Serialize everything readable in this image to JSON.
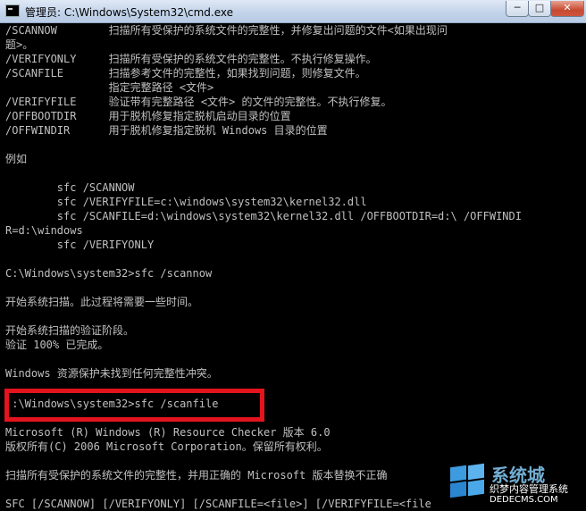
{
  "window": {
    "title": "管理员: C:\\Windows\\System32\\cmd.exe",
    "minimize": "─",
    "maximize": "□",
    "close": "✕"
  },
  "console": {
    "lines": [
      "/SCANNOW        扫描所有受保护的系统文件的完整性，并修复出问题的文件<如果出现问",
      "题>。",
      "/VERIFYONLY     扫描所有受保护的系统文件的完整性。不执行修复操作。",
      "/SCANFILE       扫描参考文件的完整性，如果找到问题，则修复文件。",
      "                指定完整路径 <文件>",
      "/VERIFYFILE     验证带有完整路径 <文件> 的文件的完整性。不执行修复。",
      "/OFFBOOTDIR     用于脱机修复指定脱机启动目录的位置",
      "/OFFWINDIR      用于脱机修复指定脱机 Windows 目录的位置",
      "",
      "例如",
      "",
      "        sfc /SCANNOW",
      "        sfc /VERIFYFILE=c:\\windows\\system32\\kernel32.dll",
      "        sfc /SCANFILE=d:\\windows\\system32\\kernel32.dll /OFFBOOTDIR=d:\\ /OFFWINDI",
      "R=d:\\windows",
      "        sfc /VERIFYONLY",
      "",
      "C:\\Windows\\system32>sfc /scannow",
      "",
      "开始系统扫描。此过程将需要一些时间。",
      "",
      "开始系统扫描的验证阶段。",
      "验证 100% 已完成。",
      "",
      "Windows 资源保护未找到任何完整性冲突。",
      "",
      " :\\Windows\\system32>sfc /scanfile",
      "Microsoft (R) Windows (R) Resource Checker 版本 6.0",
      "版权所有(C) 2006 Microsoft Corporation。保留所有权利。",
      "",
      "扫描所有受保护的系统文件的完整性，并用正确的 Microsoft 版本替换不正确",
      "",
      "SFC [/SCANNOW] [/VERIFYONLY] [/SCANFILE=<file>] [/VERIFYFILE=<file"
    ]
  },
  "watermark": {
    "title": "系统城",
    "subtitle": "织梦内容管理系统",
    "url": "DEDECMS.COM"
  },
  "colors": {
    "console_bg": "#000000",
    "console_text": "#c0c0c0",
    "highlight_border": "#e3141d"
  }
}
